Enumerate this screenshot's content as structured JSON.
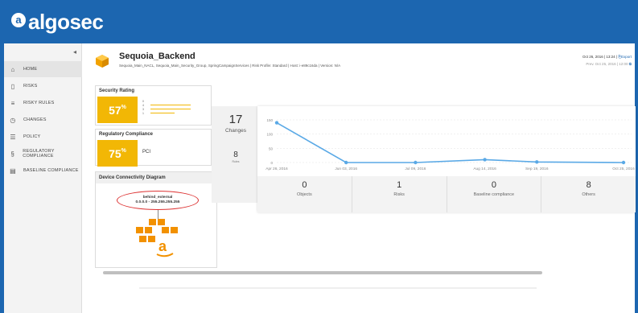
{
  "brand": {
    "logo_mark": "a",
    "name": "algosec"
  },
  "sidebar": {
    "collapse_icon": "chevron-left-icon",
    "items": [
      {
        "label": "HOME",
        "icon": "home-icon",
        "active": true
      },
      {
        "label": "RISKS",
        "icon": "risk-icon"
      },
      {
        "label": "RISKY RULES",
        "icon": "risky-rules-icon"
      },
      {
        "label": "CHANGES",
        "icon": "history-icon"
      },
      {
        "label": "POLICY",
        "icon": "list-icon"
      },
      {
        "label": "REGULATORY COMPLIANCE",
        "icon": "compliance-icon"
      },
      {
        "label": "BASELINE COMPLIANCE",
        "icon": "document-icon"
      }
    ]
  },
  "device": {
    "name": "Sequoia_Backend",
    "details": "Sequoia_Main_NACL, Sequoia_Main_Security_Group, SpringCampaignServices | Risk Profile: Standard | Host: i-e89c16da | Version: N/A",
    "date": "Oct 26, 2016",
    "time": "13:24",
    "export_label": "Export",
    "previous": "Prev. Oct 25, 2016 | 12:00"
  },
  "security_rating": {
    "title": "Security Rating",
    "value": "57",
    "unit": "%",
    "rows": [
      {
        "label": "0",
        "fraction": 0
      },
      {
        "label": "4",
        "fraction": 0.9
      },
      {
        "label": "3",
        "fraction": 0.9
      },
      {
        "label": "1",
        "fraction": 0.55
      }
    ]
  },
  "regulatory": {
    "title": "Regulatory Compliance",
    "value": "75",
    "unit": "%",
    "label": "PCI"
  },
  "connectivity": {
    "title": "Device Connectivity Diagram",
    "node_name": "behind_external",
    "node_range": "0.0.0.0 - 255.255.255.255",
    "cloud_icon": "aws-icon"
  },
  "changes": {
    "count": "17",
    "label": "Changes",
    "rules_count": "8",
    "rules_label": "Rules"
  },
  "chart_data": {
    "type": "line",
    "categories": [
      "Apr 26, 2016",
      "Jun 03, 2016",
      "Jul 09, 2016",
      "Aug 14, 2016",
      "Sep 19, 2016",
      "Oct 25, 2016"
    ],
    "x": [
      0,
      1,
      2,
      3,
      3.75,
      5
    ],
    "values": [
      140,
      0,
      0,
      10,
      2,
      0
    ],
    "ylim": [
      0,
      150
    ],
    "yticks": [
      "0",
      "50",
      "100",
      "150"
    ],
    "top_tick": "150",
    "grid": true,
    "color": "#5aa9e6"
  },
  "stats": [
    {
      "value": "0",
      "label": "Objects"
    },
    {
      "value": "1",
      "label": "Risks"
    },
    {
      "value": "0",
      "label": "Baseline compliance"
    },
    {
      "value": "8",
      "label": "Others"
    }
  ],
  "colors": {
    "header": "#1c66b0",
    "accent": "#f2b705",
    "line": "#5aa9e6"
  }
}
